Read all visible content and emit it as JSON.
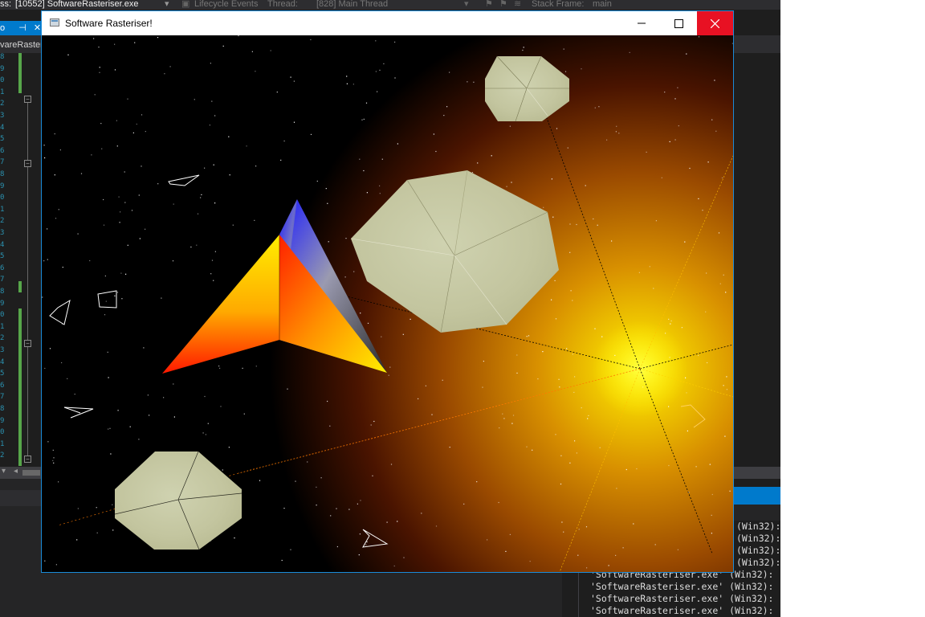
{
  "ide": {
    "process_label": "ss:",
    "process_value": "[10552] SoftwareRasteriser.exe",
    "lifecycle_label": "Lifecycle Events",
    "thread_label": "Thread:",
    "thread_value": "[828] Main Thread",
    "stack_frame_label": "Stack Frame:",
    "stack_frame_value": "main",
    "tab_label": "o",
    "editor_tab_label": "vareRaster",
    "gutter_numbers": [
      "8",
      "9",
      "0",
      "1",
      "2",
      "3",
      "4",
      "5",
      "6",
      "7",
      "8",
      "9",
      "0",
      "1",
      "2",
      "3",
      "4",
      "5",
      "6",
      "7",
      "8",
      "9",
      "0",
      "1",
      "2",
      "3",
      "4",
      "5",
      "6",
      "7",
      "8",
      "9",
      "0",
      "1",
      "2"
    ],
    "output_lines": [
      {
        "text": "(Win32):",
        "short": true
      },
      {
        "text": "(Win32):",
        "short": true
      },
      {
        "text": "(Win32):",
        "short": true
      },
      {
        "text": "(Win32):",
        "short": true
      },
      {
        "text": "'SoftwareRasteriser.exe' (Win32):",
        "short": false
      },
      {
        "text": "'SoftwareRasteriser.exe' (Win32):",
        "short": false
      },
      {
        "text": "'SoftwareRasteriser.exe' (Win32):",
        "short": false
      },
      {
        "text": "'SoftwareRasteriser.exe' (Win32):",
        "short": false
      }
    ]
  },
  "window": {
    "title": "Software Rasteriser!",
    "minimize_glyph": "—",
    "maximize_glyph": "☐",
    "close_glyph": "✕",
    "colors": {
      "border": "#1a8bd8",
      "close": "#e81123",
      "sun": "#ffee00",
      "space": "#000000",
      "asteroid": "#c8caa6"
    }
  }
}
